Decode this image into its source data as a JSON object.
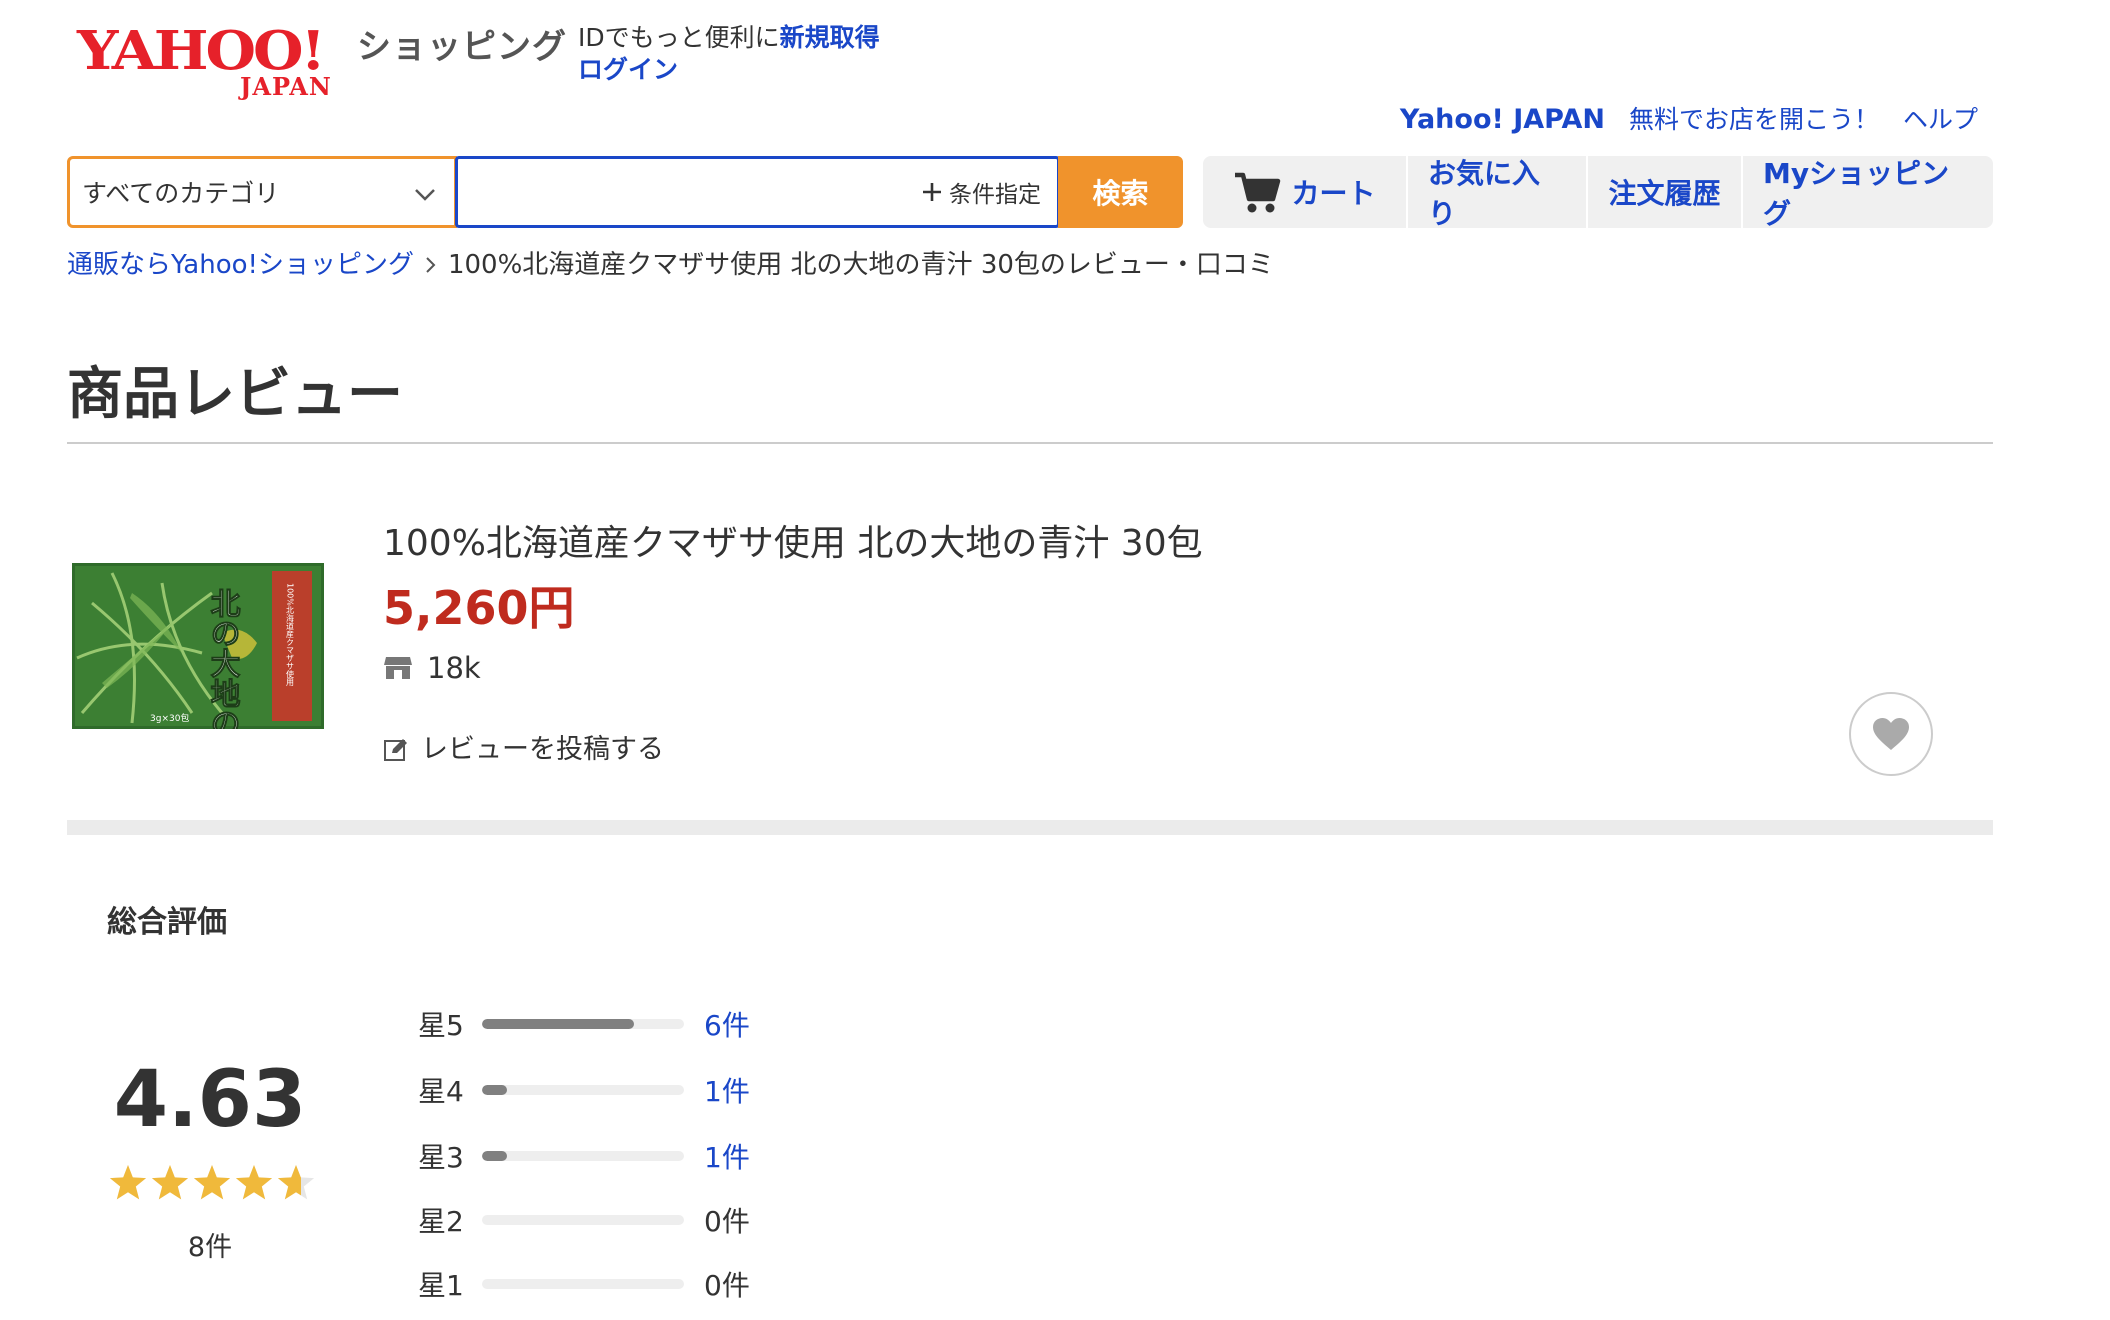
{
  "header": {
    "logo_main": "YAHOO!",
    "logo_sub": "JAPAN",
    "service_name": "ショッピング",
    "id_promo_text": "IDでもっと便利に",
    "register_label": "新規取得",
    "login_label": "ログイン"
  },
  "top_links": {
    "yahoo_japan": "Yahoo! JAPAN",
    "open_store": "無料でお店を開こう！",
    "help": "ヘルプ"
  },
  "search": {
    "category_value": "すべてのカテゴリ",
    "query_value": "",
    "condition_label": "条件指定",
    "submit_label": "検索"
  },
  "nav": {
    "cart": "カート",
    "favorites": "お気に入り",
    "order_history": "注文履歴",
    "my_shopping": "Myショッピング"
  },
  "breadcrumb": {
    "home": "通販ならYahoo!ショッピング",
    "current": "100%北海道産クマザサ使用 北の大地の青汁 30包のレビュー・口コミ"
  },
  "page": {
    "title": "商品レビュー"
  },
  "product": {
    "name": "100%北海道産クマザサ使用 北の大地の青汁 30包",
    "price": "5,260円",
    "store_count": "18k",
    "write_review_label": "レビューを投稿する",
    "package_text_main": "北の大地の青汁",
    "package_text_side": "100%北海道産クマザサ使用",
    "package_text_bottom": "3g×30包"
  },
  "ratings": {
    "section_label": "総合評価",
    "average": "4.63",
    "average_value": 4.63,
    "total": "8件",
    "distribution": [
      {
        "label": "星5",
        "count": "6件",
        "fraction": 0.75
      },
      {
        "label": "星4",
        "count": "1件",
        "fraction": 0.125
      },
      {
        "label": "星3",
        "count": "1件",
        "fraction": 0.125
      },
      {
        "label": "星2",
        "count": "0件",
        "fraction": 0
      },
      {
        "label": "星1",
        "count": "0件",
        "fraction": 0
      }
    ]
  },
  "colors": {
    "link_blue": "#1a47c8",
    "accent_orange": "#f0932c",
    "price_red": "#bf2b1e",
    "star_gold": "#f0b93b",
    "logo_red": "#e6212a"
  }
}
